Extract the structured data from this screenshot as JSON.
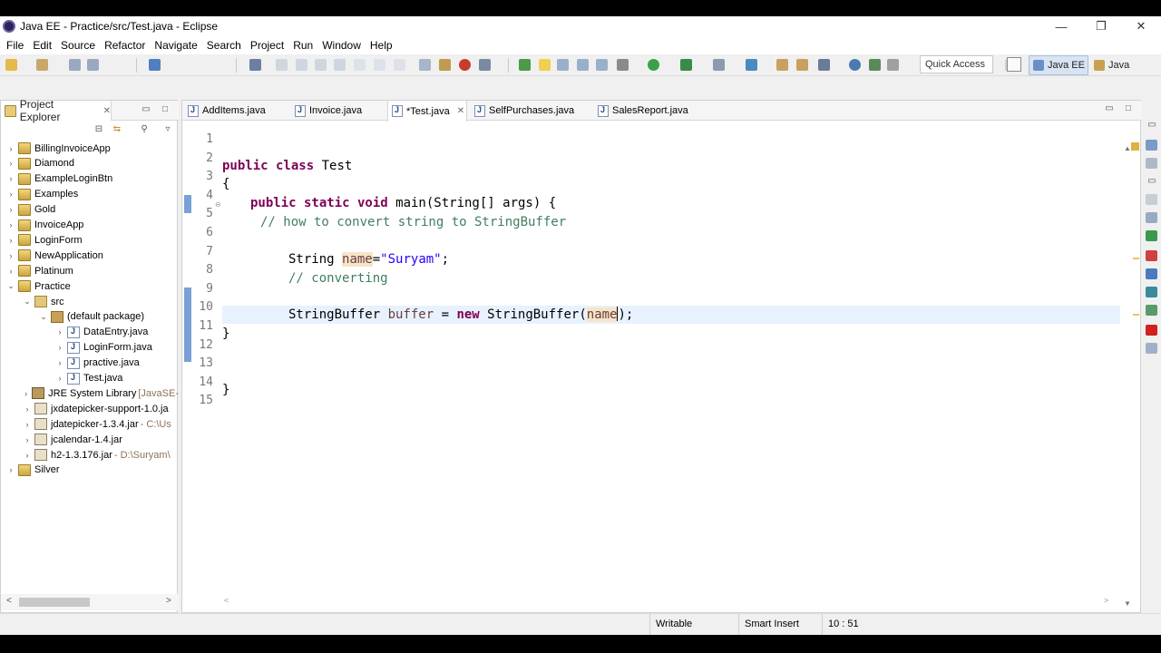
{
  "window": {
    "title": "Java EE - Practice/src/Test.java - Eclipse",
    "minimize_glyph": "—",
    "restore_glyph": "❐",
    "close_glyph": "✕"
  },
  "menu": [
    "File",
    "Edit",
    "Source",
    "Refactor",
    "Navigate",
    "Search",
    "Project",
    "Run",
    "Window",
    "Help"
  ],
  "toolbar": {
    "quick_access_placeholder": "Quick Access",
    "perspectives": [
      "Java EE",
      "Java"
    ]
  },
  "explorer": {
    "title": "Project Explorer",
    "tree": [
      {
        "label": "BillingInvoiceApp",
        "depth": 0,
        "twisty": ">",
        "icon": "project-icon"
      },
      {
        "label": "Diamond",
        "depth": 0,
        "twisty": ">",
        "icon": "project-icon"
      },
      {
        "label": "ExampleLoginBtn",
        "depth": 0,
        "twisty": ">",
        "icon": "project-icon"
      },
      {
        "label": "Examples",
        "depth": 0,
        "twisty": ">",
        "icon": "project-icon"
      },
      {
        "label": "Gold",
        "depth": 0,
        "twisty": ">",
        "icon": "project-icon"
      },
      {
        "label": "InvoiceApp",
        "depth": 0,
        "twisty": ">",
        "icon": "project-icon"
      },
      {
        "label": "LoginForm",
        "depth": 0,
        "twisty": ">",
        "icon": "project-icon"
      },
      {
        "label": "NewApplication",
        "depth": 0,
        "twisty": ">",
        "icon": "project-icon"
      },
      {
        "label": "Platinum",
        "depth": 0,
        "twisty": ">",
        "icon": "project-icon"
      },
      {
        "label": "Practice",
        "depth": 0,
        "twisty": "v",
        "icon": "project-icon"
      },
      {
        "label": "src",
        "depth": 1,
        "twisty": "v",
        "icon": "source-folder-icon"
      },
      {
        "label": "(default package)",
        "depth": 2,
        "twisty": "v",
        "icon": "package-icon"
      },
      {
        "label": "DataEntry.java",
        "depth": 3,
        "twisty": ">",
        "icon": "java-file-icon"
      },
      {
        "label": "LoginForm.java",
        "depth": 3,
        "twisty": ">",
        "icon": "java-file-icon"
      },
      {
        "label": "practive.java",
        "depth": 3,
        "twisty": ">",
        "icon": "java-file-icon"
      },
      {
        "label": "Test.java",
        "depth": 3,
        "twisty": ">",
        "icon": "java-file-icon"
      },
      {
        "label": "JRE System Library",
        "deco": "[JavaSE-",
        "depth": 1,
        "twisty": ">",
        "icon": "library-icon"
      },
      {
        "label": "jxdatepicker-support-1.0.ja",
        "depth": 1,
        "twisty": ">",
        "icon": "jar-icon"
      },
      {
        "label": "jdatepicker-1.3.4.jar",
        "deco": "- C:\\Us",
        "depth": 1,
        "twisty": ">",
        "icon": "jar-icon"
      },
      {
        "label": "jcalendar-1.4.jar",
        "depth": 1,
        "twisty": ">",
        "icon": "jar-icon"
      },
      {
        "label": "h2-1.3.176.jar",
        "deco": "- D:\\Suryam\\",
        "depth": 1,
        "twisty": ">",
        "icon": "jar-icon"
      },
      {
        "label": "Silver",
        "depth": 0,
        "twisty": ">",
        "icon": "project-icon"
      }
    ]
  },
  "editor": {
    "tabs": [
      {
        "label": "AddItems.java",
        "active": false
      },
      {
        "label": "Invoice.java",
        "active": false
      },
      {
        "label": "*Test.java",
        "active": true
      },
      {
        "label": "SelfPurchases.java",
        "active": false
      },
      {
        "label": "SalesReport.java",
        "active": false
      }
    ],
    "line_numbers": [
      "1",
      "2",
      "3",
      "4",
      "5",
      "6",
      "7",
      "8",
      "9",
      "10",
      "11",
      "12",
      "13",
      "14",
      "15"
    ],
    "code": {
      "l2_kw": "public class",
      "l2_name": " Test",
      "l3": "{",
      "l4_kw": "public static void",
      "l4_rest": " main(String[] args) {",
      "l5": "// how to convert string to StringBuffer",
      "l7_type": "String ",
      "l7_var": "name",
      "l7_eq": "=",
      "l7_str": "\"Suryam\"",
      "l7_end": ";",
      "l8": "// converting",
      "l10_type": "StringBuffer ",
      "l10_var": "buffer",
      "l10_eq": " = ",
      "l10_kw": "new",
      "l10_call": " StringBuffer(",
      "l10_arg": "name",
      "l10_end": ");",
      "l11": "}",
      "l14": "}"
    }
  },
  "status": {
    "mode": "Writable",
    "insert": "Smart Insert",
    "position": "10 : 51"
  }
}
